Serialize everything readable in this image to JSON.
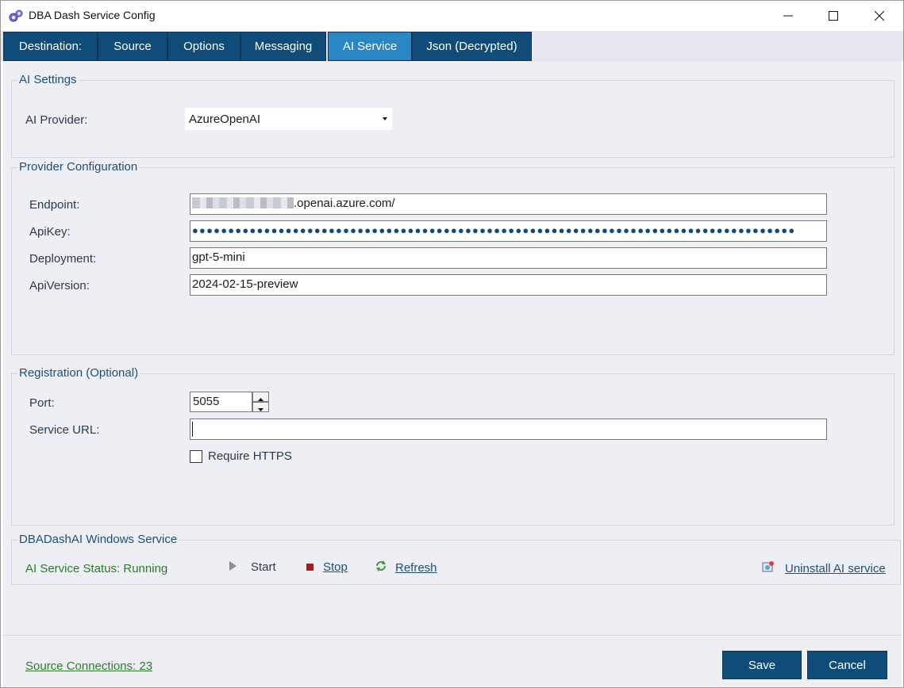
{
  "window": {
    "title": "DBA Dash Service Config",
    "minimize_icon": "minimize-icon",
    "maximize_icon": "maximize-icon",
    "close_icon": "close-icon"
  },
  "tabs": [
    {
      "label": "Destination:"
    },
    {
      "label": "Source"
    },
    {
      "label": "Options"
    },
    {
      "label": "Messaging"
    },
    {
      "label": "AI Service",
      "active": true
    },
    {
      "label": "Json (Decrypted)"
    }
  ],
  "ai_settings": {
    "title": "AI Settings",
    "provider_label": "AI Provider:",
    "provider_value": "AzureOpenAI"
  },
  "provider_config": {
    "title": "Provider Configuration",
    "endpoint_label": "Endpoint:",
    "endpoint_value": ".openai.azure.com/",
    "apikey_label": "ApiKey:",
    "apikey_value": "●●●●●●●●●●●●●●●●●●●●●●●●●●●●●●●●●●●●●●●●●●●●●●●●●●●●●●●●●●●●●●●●●●●●●●●●●●●●●●●●●●●●",
    "deployment_label": "Deployment:",
    "deployment_value": "gpt-5-mini",
    "apiversion_label": "ApiVersion:",
    "apiversion_value": "2024-02-15-preview"
  },
  "registration": {
    "title": "Registration (Optional)",
    "port_label": "Port:",
    "port_value": "5055",
    "service_url_label": "Service URL:",
    "service_url_value": "",
    "require_https_label": "Require HTTPS",
    "require_https_checked": false
  },
  "windows_service": {
    "title": "DBADashAI Windows Service",
    "status_text": "AI Service Status: Running",
    "start_label": "Start",
    "stop_label": "Stop",
    "refresh_label": "Refresh",
    "uninstall_label": "Uninstall AI service"
  },
  "footer": {
    "source_connections": "Source Connections: 23",
    "save_label": "Save",
    "cancel_label": "Cancel"
  },
  "colors": {
    "tab_bg": "#0f4c7a",
    "tab_active_bg": "#2b86c5",
    "status_green": "#2d7a2d",
    "group_title": "#1f4e79"
  }
}
